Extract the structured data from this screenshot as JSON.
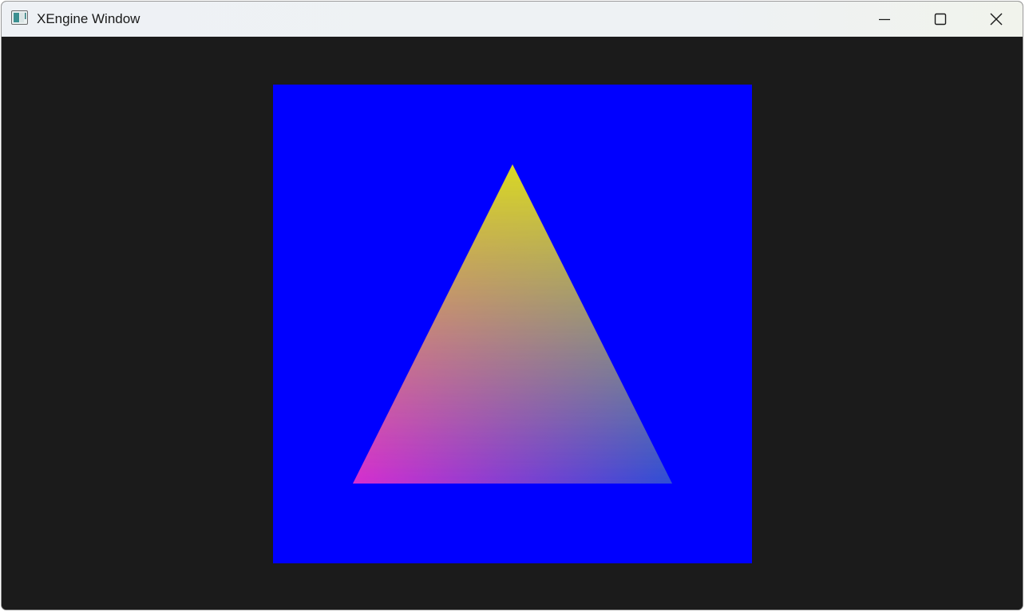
{
  "window": {
    "title": "XEngine Window",
    "app_icon": "app-window-icon"
  },
  "controls": {
    "minimize_icon": "minimize-icon",
    "maximize_icon": "maximize-icon",
    "close_icon": "close-icon"
  },
  "scene": {
    "clear_color": "#0000ff",
    "background_color": "#1b1b1b",
    "triangle": {
      "top_vertex_color": "#d8d824",
      "bottom_left_vertex_color": "#d62ed0",
      "bottom_right_vertex_color": "#2f4ed6"
    }
  }
}
